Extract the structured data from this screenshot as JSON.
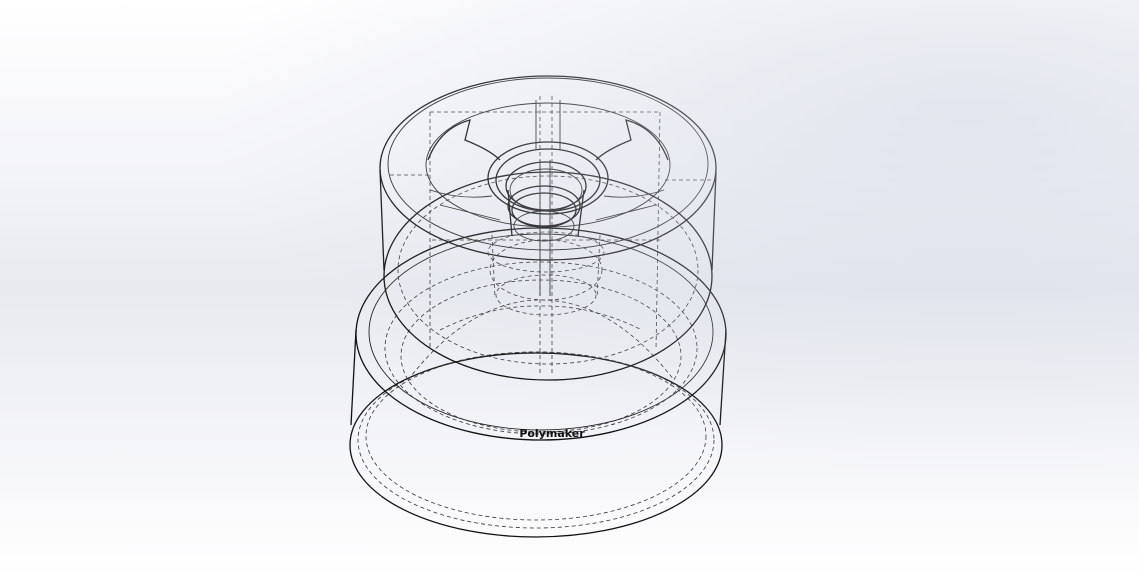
{
  "model": {
    "engraved_text": "Polymaker",
    "line_color": "#111111",
    "hidden_line_color": "#333333",
    "background_top": "#ffffff",
    "background_band": "#e8eaf0"
  }
}
